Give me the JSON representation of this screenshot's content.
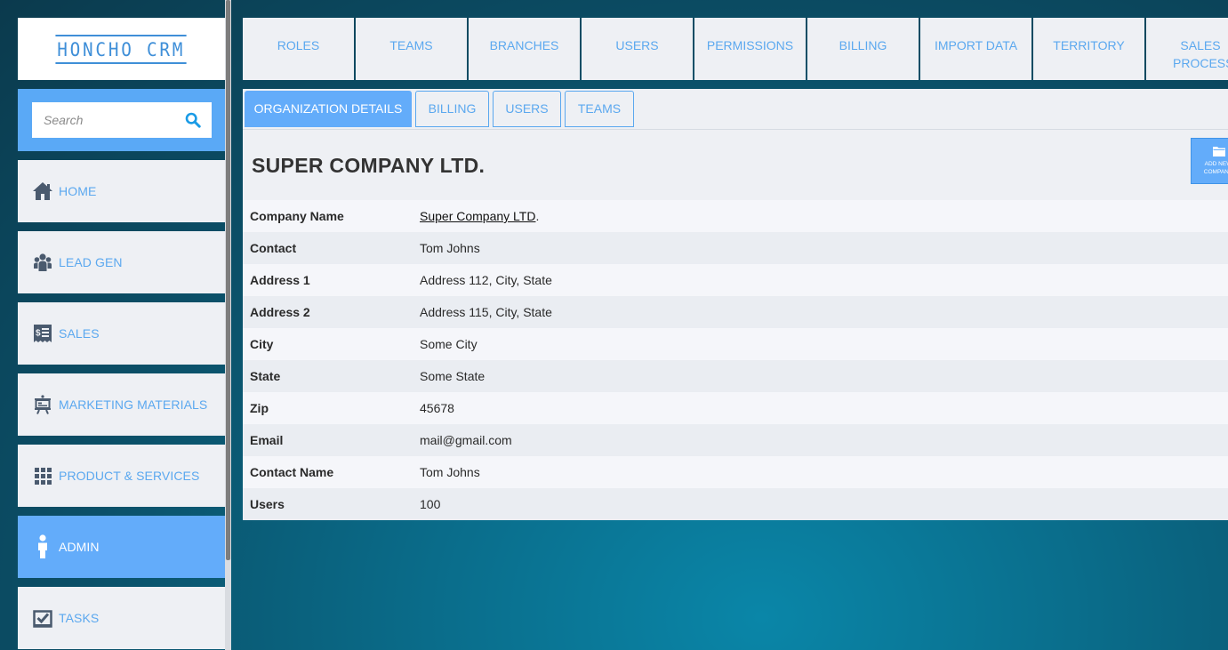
{
  "brand": {
    "logo_text": "HONCHO CRM",
    "accent_color": "#5aa9f6",
    "active_color": "#63acfa"
  },
  "search": {
    "placeholder": "Search",
    "value": ""
  },
  "sidebar": {
    "items": [
      {
        "label": "HOME",
        "icon": "home-icon"
      },
      {
        "label": "LEAD GEN",
        "icon": "users-group-icon"
      },
      {
        "label": "SALES",
        "icon": "sales-receipt-icon"
      },
      {
        "label": "MARKETING MATERIALS",
        "icon": "presentation-board-icon"
      },
      {
        "label": "PRODUCT & SERVICES",
        "icon": "grid-icon"
      },
      {
        "label": "ADMIN",
        "icon": "person-icon",
        "active": true
      },
      {
        "label": "TASKS",
        "icon": "checkbox-icon"
      }
    ]
  },
  "top_tabs": [
    "ROLES",
    "TEAMS",
    "BRANCHES",
    "USERS",
    "PERMISSIONS",
    "BILLING",
    "IMPORT DATA",
    "TERRITORY",
    "SALES PROCESS"
  ],
  "sub_tabs": [
    {
      "label": "ORGANIZATION DETAILS",
      "active": true
    },
    {
      "label": "BILLING",
      "active": false
    },
    {
      "label": "USERS",
      "active": false
    },
    {
      "label": "TEAMS",
      "active": false
    }
  ],
  "page": {
    "title": "SUPER COMPANY LTD.",
    "add_button_label": "ADD NEW COMPANY",
    "add_button_icon": "folder-icon"
  },
  "details": {
    "rows": [
      {
        "label": "Company Name",
        "value": "Super Company LTD",
        "suffix": "."
      },
      {
        "label": "Contact",
        "value": "Tom Johns"
      },
      {
        "label": "Address 1",
        "value": "Address 112, City, State"
      },
      {
        "label": "Address 2",
        "value": "Address 115, City, State"
      },
      {
        "label": "City",
        "value": "Some City"
      },
      {
        "label": "State",
        "value": "Some State"
      },
      {
        "label": "Zip",
        "value": "45678"
      },
      {
        "label": "Email",
        "value": "mail@gmail.com"
      },
      {
        "label": "Contact Name",
        "value": "Tom Johns"
      },
      {
        "label": "Users",
        "value": "100"
      }
    ]
  }
}
